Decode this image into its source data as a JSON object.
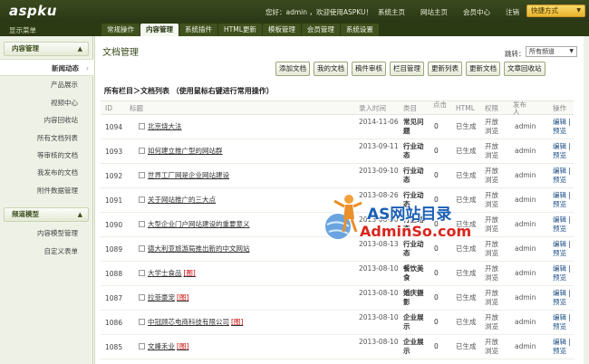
{
  "header": {
    "logo": "aspku",
    "welcome": "您好：admin ，欢迎使用ASPKU！",
    "links": [
      "系统主页",
      "网站主页",
      "会员中心",
      "注销"
    ],
    "quick_button": "快捷方式"
  },
  "nav": {
    "menu_label": "显示菜单",
    "tabs": [
      "常规操作",
      "内容管理",
      "系统插件",
      "HTML更新",
      "模板管理",
      "会员管理",
      "系统设置"
    ]
  },
  "sidebar": {
    "sections": [
      {
        "title": "内容管理",
        "items": [
          "新闻动态",
          "产品展示",
          "视频中心",
          "内容回收站",
          "所有文档列表",
          "等审核的文档",
          "我发布的文档",
          "附件数据管理"
        ]
      },
      {
        "title": "频道模型",
        "items": [
          "内容模型管理",
          "自定义表单"
        ]
      }
    ]
  },
  "main": {
    "title": "文档管理",
    "jump_label": "跳转：",
    "jump_value": "所有频道",
    "actions": [
      "添加文档",
      "我的文档",
      "稿件审核",
      "栏目管理",
      "更新列表",
      "更新文档",
      "文章回收站"
    ],
    "breadcrumb": "所有栏目＞文档列表 （使用鼠标右键进行常用操作）",
    "columns": [
      "ID",
      "标题",
      "录入时间",
      "类目",
      "点击",
      "HTML",
      "权限",
      "发布人",
      "操作"
    ],
    "rows": [
      {
        "id": "1094",
        "title": "北京烧大法",
        "img": "",
        "date": "2014-11-06",
        "cat": "常见问题",
        "clicks": "0",
        "html": "已生成",
        "perm": "开放浏览",
        "pub": "admin",
        "ops": "编辑 | 预览"
      },
      {
        "id": "1093",
        "title": "如何建立推广型的网站群",
        "img": "",
        "date": "2013-09-11",
        "cat": "行业动态",
        "clicks": "0",
        "html": "已生成",
        "perm": "开放浏览",
        "pub": "admin",
        "ops": "编辑 | 预览"
      },
      {
        "id": "1092",
        "title": "世界工厂网是企业网站建设",
        "img": "",
        "date": "2013-09-10",
        "cat": "行业动态",
        "clicks": "0",
        "html": "已生成",
        "perm": "开放浏览",
        "pub": "admin",
        "ops": "编辑 | 预览"
      },
      {
        "id": "1091",
        "title": "关于网站推广的三大点",
        "img": "",
        "date": "2013-08-26",
        "cat": "行业动态",
        "clicks": "0",
        "html": "已生成",
        "perm": "开放浏览",
        "pub": "admin",
        "ops": "编辑 | 预览"
      },
      {
        "id": "1090",
        "title": "大型企业门户网站建设的重要意义",
        "img": "",
        "date": "2013-08-20",
        "cat": "行业动态",
        "clicks": "0",
        "html": "已生成",
        "perm": "开放浏览",
        "pub": "admin",
        "ops": "编辑 | 预览"
      },
      {
        "id": "1089",
        "title": "德大利亚旅游局推出新的中文网站",
        "img": "",
        "date": "2013-08-13",
        "cat": "行业动态",
        "clicks": "0",
        "html": "已生成",
        "perm": "开放浏览",
        "pub": "admin",
        "ops": "编辑 | 预览"
      },
      {
        "id": "1088",
        "title": "大学士食品",
        "img": "[图]",
        "date": "2013-08-10",
        "cat": "餐饮美食",
        "clicks": "0",
        "html": "已生成",
        "perm": "开放浏览",
        "pub": "admin",
        "ops": "编辑 | 预览"
      },
      {
        "id": "1087",
        "title": "拉菲豪宠",
        "img": "[图]",
        "date": "2013-08-10",
        "cat": "婚庆摄影",
        "clicks": "0",
        "html": "已生成",
        "perm": "开放浏览",
        "pub": "admin",
        "ops": "编辑 | 预览"
      },
      {
        "id": "1086",
        "title": "中冠顾芯电商科技有限公司",
        "img": "[图]",
        "date": "2013-08-10",
        "cat": "企业展示",
        "clicks": "0",
        "html": "已生成",
        "perm": "开放浏览",
        "pub": "admin",
        "ops": "编辑 | 预览"
      },
      {
        "id": "1085",
        "title": "文峰禾业",
        "img": "[图]",
        "date": "2013-08-10",
        "cat": "企业展示",
        "clicks": "0",
        "html": "已生成",
        "perm": "开放浏览",
        "pub": "admin",
        "ops": "编辑 | 预览"
      }
    ]
  },
  "watermark": {
    "line1": "AS网站目录",
    "line2": "AdminSo.com"
  },
  "colors": {
    "header_bg": "#34441a",
    "nav_bg": "#2c3a13",
    "accent": "#e7b52d",
    "link_blue": "#1a4d86",
    "img_tag_red": "#cc0000"
  }
}
